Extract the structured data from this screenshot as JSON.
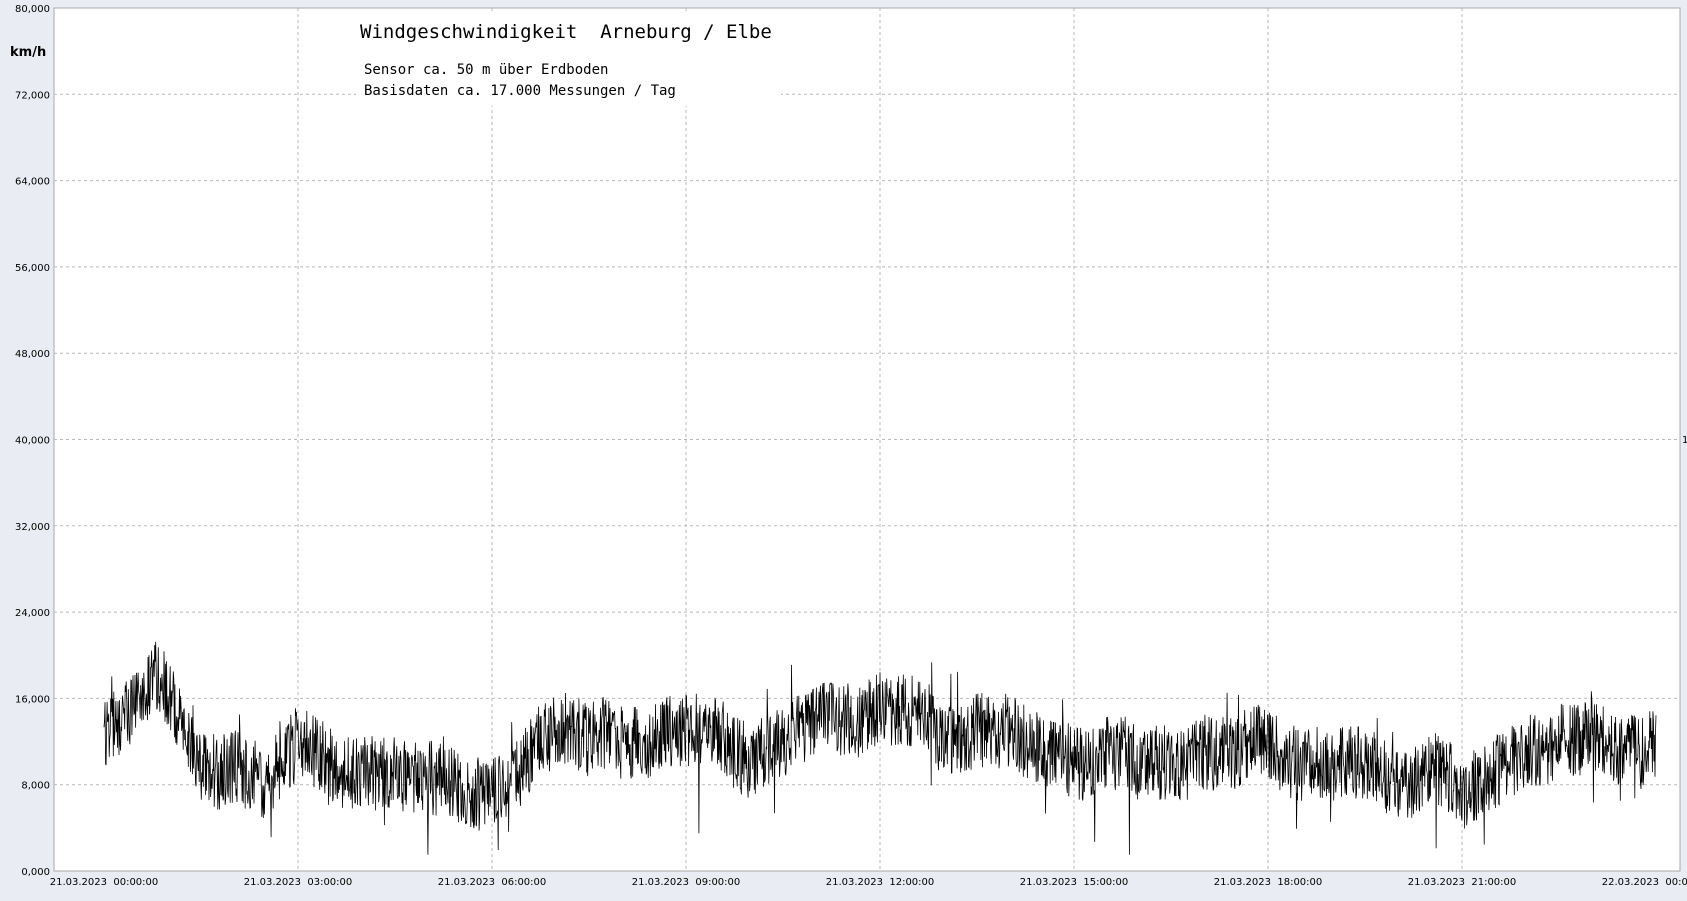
{
  "chart_data": {
    "type": "line",
    "title": "Windgeschwindigkeit  Arneburg / Elbe",
    "subtitle_lines": [
      "Sensor ca. 50 m über Erdboden",
      "Basisdaten ca. 17.000 Messungen / Tag"
    ],
    "ylabel": "km/h",
    "xlabel": "",
    "ylim": [
      0,
      80
    ],
    "yticks": [
      0,
      8,
      16,
      24,
      32,
      40,
      48,
      56,
      64,
      72,
      80
    ],
    "ytick_labels": [
      "0,000",
      "8,000",
      "16,000",
      "24,000",
      "32,000",
      "40,000",
      "48,000",
      "56,000",
      "64,000",
      "72,000",
      "80,000"
    ],
    "xlim_hours": [
      0,
      24
    ],
    "xticks_hours": [
      0,
      3,
      6,
      9,
      12,
      15,
      18,
      21,
      24
    ],
    "xtick_labels": [
      "21.03.2023  00:00:00",
      "21.03.2023  03:00:00",
      "21.03.2023  06:00:00",
      "21.03.2023  09:00:00",
      "21.03.2023  12:00:00",
      "21.03.2023  15:00:00",
      "21.03.2023  18:00:00",
      "21.03.2023  21:00:00",
      "22.03.2023  00:00:00"
    ],
    "grid": true,
    "right_edge_label": "1",
    "series": [
      {
        "color": "#000000",
        "x_hours": [
          0,
          0.25,
          0.5,
          0.75,
          1.0,
          1.25,
          1.5,
          1.75,
          2.0,
          2.25,
          2.5,
          2.75,
          3.0,
          3.25,
          3.5,
          3.75,
          4.0,
          4.25,
          4.5,
          4.75,
          5.0,
          5.25,
          5.5,
          5.75,
          6.0,
          6.25,
          6.5,
          6.75,
          7.0,
          7.25,
          7.5,
          7.75,
          8.0,
          8.25,
          8.5,
          8.75,
          9.0,
          9.25,
          9.5,
          9.75,
          10.0,
          10.25,
          10.5,
          10.75,
          11.0,
          11.25,
          11.5,
          11.75,
          12.0,
          12.25,
          12.5,
          12.75,
          13.0,
          13.25,
          13.5,
          13.75,
          14.0,
          14.25,
          14.5,
          14.75,
          15.0,
          15.25,
          15.5,
          15.75,
          16.0,
          16.25,
          16.5,
          16.75,
          17.0,
          17.25,
          17.5,
          17.75,
          18.0,
          18.25,
          18.5,
          18.75,
          19.0,
          19.25,
          19.5,
          19.75,
          20.0,
          20.25,
          20.5,
          20.75,
          21.0,
          21.25,
          21.5,
          21.75,
          22.0,
          22.25,
          22.5,
          22.75,
          23.0,
          23.25,
          23.5,
          23.75,
          24.0
        ],
        "values": [
          13,
          14,
          16,
          18,
          17,
          12,
          10,
          9,
          10,
          9,
          8,
          10,
          12,
          11,
          10,
          9,
          9,
          9,
          9,
          9,
          9,
          8,
          8,
          7,
          8,
          7,
          10,
          12,
          13,
          13,
          12,
          13,
          12,
          12,
          12,
          13,
          13,
          13,
          13,
          11,
          10,
          11,
          12,
          13,
          14,
          14,
          14,
          14,
          15,
          15,
          15,
          14,
          12,
          12,
          13,
          13,
          13,
          12,
          11,
          11,
          10,
          10,
          11,
          11,
          10,
          10,
          10,
          10,
          11,
          11,
          11,
          12,
          12,
          10,
          10,
          10,
          10,
          10,
          10,
          9,
          8,
          8,
          10,
          9,
          7,
          8,
          9,
          10,
          11,
          11,
          12,
          12,
          13,
          12,
          11,
          11,
          12
        ],
        "noise_amplitude": 3.5
      }
    ]
  }
}
